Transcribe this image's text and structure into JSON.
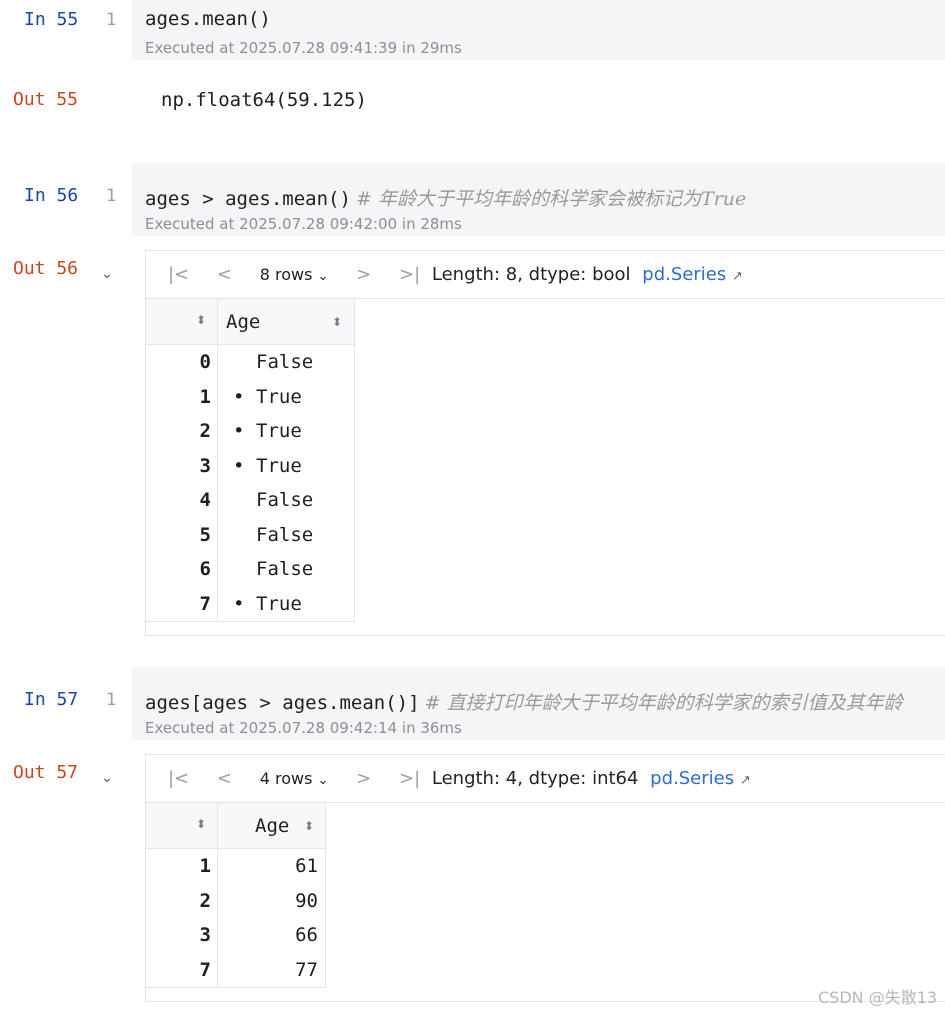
{
  "cells": [
    {
      "in_label": "In 55",
      "line_no": "1",
      "code": "ages.mean()",
      "comment": "",
      "exec": "Executed at 2025.07.28 09:41:39 in 29ms",
      "out_label": "Out 55",
      "output_text": "np.float64(59.125)"
    },
    {
      "in_label": "In 56",
      "line_no": "1",
      "code": "ages > ages.mean()",
      "comment": "# 年龄大于平均年龄的科学家会被标记为True",
      "exec": "Executed at 2025.07.28 09:42:00 in 28ms",
      "out_label": "Out 56",
      "toolbar": {
        "rows": "8 rows",
        "info": "Length: 8, dtype: bool",
        "link": "pd.Series"
      },
      "table": {
        "header": "Age",
        "rows": [
          {
            "idx": "0",
            "val": "False",
            "bullet": ""
          },
          {
            "idx": "1",
            "val": "True",
            "bullet": "•"
          },
          {
            "idx": "2",
            "val": "True",
            "bullet": "•"
          },
          {
            "idx": "3",
            "val": "True",
            "bullet": "•"
          },
          {
            "idx": "4",
            "val": "False",
            "bullet": ""
          },
          {
            "idx": "5",
            "val": "False",
            "bullet": ""
          },
          {
            "idx": "6",
            "val": "False",
            "bullet": ""
          },
          {
            "idx": "7",
            "val": "True",
            "bullet": "•"
          }
        ]
      }
    },
    {
      "in_label": "In 57",
      "line_no": "1",
      "code": "ages[ages > ages.mean()]",
      "comment": "# 直接打印年龄大于平均年龄的科学家的索引值及其年龄",
      "exec": "Executed at 2025.07.28 09:42:14 in 36ms",
      "out_label": "Out 57",
      "toolbar": {
        "rows": "4 rows",
        "info": "Length: 4, dtype: int64",
        "link": "pd.Series"
      },
      "table": {
        "header": "Age",
        "rows": [
          {
            "idx": "1",
            "val": "61"
          },
          {
            "idx": "2",
            "val": "90"
          },
          {
            "idx": "3",
            "val": "66"
          },
          {
            "idx": "7",
            "val": "77"
          }
        ]
      }
    }
  ],
  "watermark": "CSDN @失散13",
  "colors": {
    "in_label": "#1a46a6",
    "out_label": "#c8471c",
    "link": "#2d6bd6",
    "cell_bg": "#f4f5f7"
  }
}
